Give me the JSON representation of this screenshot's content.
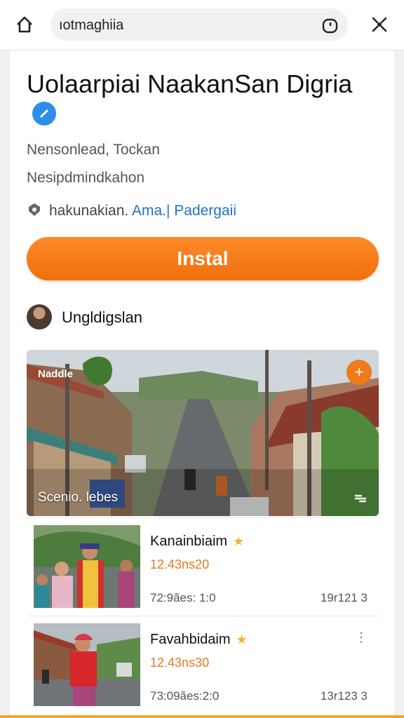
{
  "browser": {
    "url_text": "ıotmaghiia"
  },
  "app": {
    "title": "Uolaarpiai NaakanSan Digria",
    "subtitle_1": "Nensonlead, Tockan",
    "subtitle_2": "Nesipdmindkahon",
    "developer_prefix": "hakunakian.",
    "developer_link": "Ama.| Padergaii",
    "install_label": "Instal",
    "author_name": "Ungldigslan"
  },
  "hero": {
    "tag": "Naddle",
    "caption": "Scenio. lebes",
    "plus": "+"
  },
  "items": [
    {
      "name": "Kanainbiaim",
      "price": "12.43ns20",
      "meta": "72:9ães: 1:0",
      "count": "19r121 3"
    },
    {
      "name": "Favahbidaim",
      "price": "12.43ns30",
      "meta": "73:09ães:2:0",
      "count": "13r123 3"
    }
  ],
  "colors": {
    "accent_orange": "#f07a1c",
    "link_blue": "#1f73c8",
    "verified_blue": "#2d8ee8"
  }
}
